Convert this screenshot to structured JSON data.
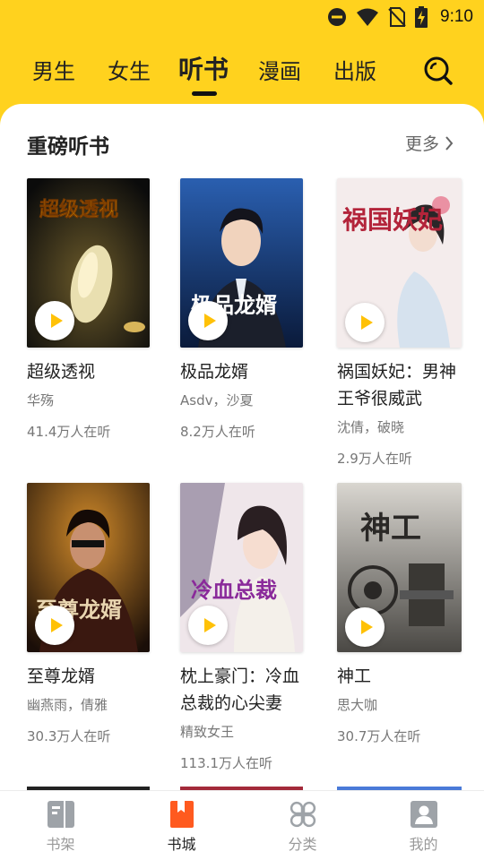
{
  "status": {
    "time": "9:10"
  },
  "tabs": [
    {
      "label": "男生",
      "active": false
    },
    {
      "label": "女生",
      "active": false
    },
    {
      "label": "听书",
      "active": true
    },
    {
      "label": "漫画",
      "active": false
    },
    {
      "label": "出版",
      "active": false
    }
  ],
  "section": {
    "title": "重磅听书",
    "more": "更多"
  },
  "books": [
    {
      "title": "超级透视",
      "author": "华殇",
      "listeners": "41.4万人在听",
      "cover_text": "超级透视"
    },
    {
      "title": "极品龙婿",
      "author": "Asdv，沙夏",
      "listeners": "8.2万人在听",
      "cover_text": "极品龙婿"
    },
    {
      "title": "祸国妖妃：男神王爷很威武",
      "author": "沈倩，破晓",
      "listeners": "2.9万人在听",
      "cover_text": "祸国妖妃"
    },
    {
      "title": "至尊龙婿",
      "author": "幽燕雨，倩雅",
      "listeners": "30.3万人在听",
      "cover_text": "至尊龙婿"
    },
    {
      "title": "枕上豪门：冷血总裁的心尖妻",
      "author": "精致女王",
      "listeners": "113.1万人在听",
      "cover_text": "冷血总裁"
    },
    {
      "title": "神工",
      "author": "思大咖",
      "listeners": "30.7万人在听",
      "cover_text": "神工"
    }
  ],
  "bottom_nav": [
    {
      "label": "书架",
      "icon": "bookshelf-icon",
      "active": false
    },
    {
      "label": "书城",
      "icon": "bookstore-icon",
      "active": true
    },
    {
      "label": "分类",
      "icon": "category-icon",
      "active": false
    },
    {
      "label": "我的",
      "icon": "profile-icon",
      "active": false
    }
  ],
  "colors": {
    "brand_yellow": "#FFD21E",
    "play_accent": "#FFC107",
    "bookstore_orange": "#FF5A1F"
  }
}
